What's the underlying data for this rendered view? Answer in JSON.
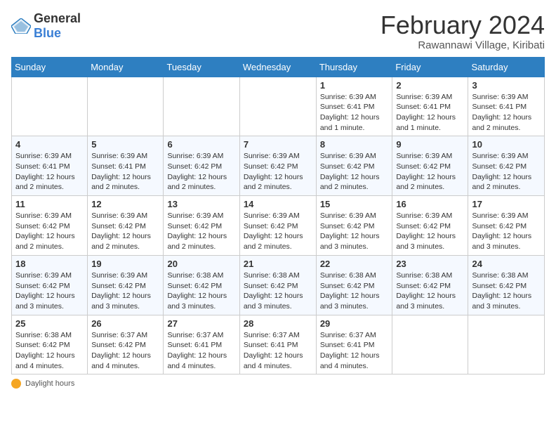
{
  "logo": {
    "general": "General",
    "blue": "Blue"
  },
  "title": "February 2024",
  "subtitle": "Rawannawi Village, Kiribati",
  "weekdays": [
    "Sunday",
    "Monday",
    "Tuesday",
    "Wednesday",
    "Thursday",
    "Friday",
    "Saturday"
  ],
  "footer": {
    "daylight_label": "Daylight hours"
  },
  "weeks": [
    [
      {
        "day": "",
        "sunrise": "",
        "sunset": "",
        "daylight": ""
      },
      {
        "day": "",
        "sunrise": "",
        "sunset": "",
        "daylight": ""
      },
      {
        "day": "",
        "sunrise": "",
        "sunset": "",
        "daylight": ""
      },
      {
        "day": "",
        "sunrise": "",
        "sunset": "",
        "daylight": ""
      },
      {
        "day": "1",
        "sunrise": "Sunrise: 6:39 AM",
        "sunset": "Sunset: 6:41 PM",
        "daylight": "Daylight: 12 hours and 1 minute."
      },
      {
        "day": "2",
        "sunrise": "Sunrise: 6:39 AM",
        "sunset": "Sunset: 6:41 PM",
        "daylight": "Daylight: 12 hours and 1 minute."
      },
      {
        "day": "3",
        "sunrise": "Sunrise: 6:39 AM",
        "sunset": "Sunset: 6:41 PM",
        "daylight": "Daylight: 12 hours and 2 minutes."
      }
    ],
    [
      {
        "day": "4",
        "sunrise": "Sunrise: 6:39 AM",
        "sunset": "Sunset: 6:41 PM",
        "daylight": "Daylight: 12 hours and 2 minutes."
      },
      {
        "day": "5",
        "sunrise": "Sunrise: 6:39 AM",
        "sunset": "Sunset: 6:41 PM",
        "daylight": "Daylight: 12 hours and 2 minutes."
      },
      {
        "day": "6",
        "sunrise": "Sunrise: 6:39 AM",
        "sunset": "Sunset: 6:42 PM",
        "daylight": "Daylight: 12 hours and 2 minutes."
      },
      {
        "day": "7",
        "sunrise": "Sunrise: 6:39 AM",
        "sunset": "Sunset: 6:42 PM",
        "daylight": "Daylight: 12 hours and 2 minutes."
      },
      {
        "day": "8",
        "sunrise": "Sunrise: 6:39 AM",
        "sunset": "Sunset: 6:42 PM",
        "daylight": "Daylight: 12 hours and 2 minutes."
      },
      {
        "day": "9",
        "sunrise": "Sunrise: 6:39 AM",
        "sunset": "Sunset: 6:42 PM",
        "daylight": "Daylight: 12 hours and 2 minutes."
      },
      {
        "day": "10",
        "sunrise": "Sunrise: 6:39 AM",
        "sunset": "Sunset: 6:42 PM",
        "daylight": "Daylight: 12 hours and 2 minutes."
      }
    ],
    [
      {
        "day": "11",
        "sunrise": "Sunrise: 6:39 AM",
        "sunset": "Sunset: 6:42 PM",
        "daylight": "Daylight: 12 hours and 2 minutes."
      },
      {
        "day": "12",
        "sunrise": "Sunrise: 6:39 AM",
        "sunset": "Sunset: 6:42 PM",
        "daylight": "Daylight: 12 hours and 2 minutes."
      },
      {
        "day": "13",
        "sunrise": "Sunrise: 6:39 AM",
        "sunset": "Sunset: 6:42 PM",
        "daylight": "Daylight: 12 hours and 2 minutes."
      },
      {
        "day": "14",
        "sunrise": "Sunrise: 6:39 AM",
        "sunset": "Sunset: 6:42 PM",
        "daylight": "Daylight: 12 hours and 2 minutes."
      },
      {
        "day": "15",
        "sunrise": "Sunrise: 6:39 AM",
        "sunset": "Sunset: 6:42 PM",
        "daylight": "Daylight: 12 hours and 3 minutes."
      },
      {
        "day": "16",
        "sunrise": "Sunrise: 6:39 AM",
        "sunset": "Sunset: 6:42 PM",
        "daylight": "Daylight: 12 hours and 3 minutes."
      },
      {
        "day": "17",
        "sunrise": "Sunrise: 6:39 AM",
        "sunset": "Sunset: 6:42 PM",
        "daylight": "Daylight: 12 hours and 3 minutes."
      }
    ],
    [
      {
        "day": "18",
        "sunrise": "Sunrise: 6:39 AM",
        "sunset": "Sunset: 6:42 PM",
        "daylight": "Daylight: 12 hours and 3 minutes."
      },
      {
        "day": "19",
        "sunrise": "Sunrise: 6:39 AM",
        "sunset": "Sunset: 6:42 PM",
        "daylight": "Daylight: 12 hours and 3 minutes."
      },
      {
        "day": "20",
        "sunrise": "Sunrise: 6:38 AM",
        "sunset": "Sunset: 6:42 PM",
        "daylight": "Daylight: 12 hours and 3 minutes."
      },
      {
        "day": "21",
        "sunrise": "Sunrise: 6:38 AM",
        "sunset": "Sunset: 6:42 PM",
        "daylight": "Daylight: 12 hours and 3 minutes."
      },
      {
        "day": "22",
        "sunrise": "Sunrise: 6:38 AM",
        "sunset": "Sunset: 6:42 PM",
        "daylight": "Daylight: 12 hours and 3 minutes."
      },
      {
        "day": "23",
        "sunrise": "Sunrise: 6:38 AM",
        "sunset": "Sunset: 6:42 PM",
        "daylight": "Daylight: 12 hours and 3 minutes."
      },
      {
        "day": "24",
        "sunrise": "Sunrise: 6:38 AM",
        "sunset": "Sunset: 6:42 PM",
        "daylight": "Daylight: 12 hours and 3 minutes."
      }
    ],
    [
      {
        "day": "25",
        "sunrise": "Sunrise: 6:38 AM",
        "sunset": "Sunset: 6:42 PM",
        "daylight": "Daylight: 12 hours and 4 minutes."
      },
      {
        "day": "26",
        "sunrise": "Sunrise: 6:37 AM",
        "sunset": "Sunset: 6:42 PM",
        "daylight": "Daylight: 12 hours and 4 minutes."
      },
      {
        "day": "27",
        "sunrise": "Sunrise: 6:37 AM",
        "sunset": "Sunset: 6:41 PM",
        "daylight": "Daylight: 12 hours and 4 minutes."
      },
      {
        "day": "28",
        "sunrise": "Sunrise: 6:37 AM",
        "sunset": "Sunset: 6:41 PM",
        "daylight": "Daylight: 12 hours and 4 minutes."
      },
      {
        "day": "29",
        "sunrise": "Sunrise: 6:37 AM",
        "sunset": "Sunset: 6:41 PM",
        "daylight": "Daylight: 12 hours and 4 minutes."
      },
      {
        "day": "",
        "sunrise": "",
        "sunset": "",
        "daylight": ""
      },
      {
        "day": "",
        "sunrise": "",
        "sunset": "",
        "daylight": ""
      }
    ]
  ]
}
